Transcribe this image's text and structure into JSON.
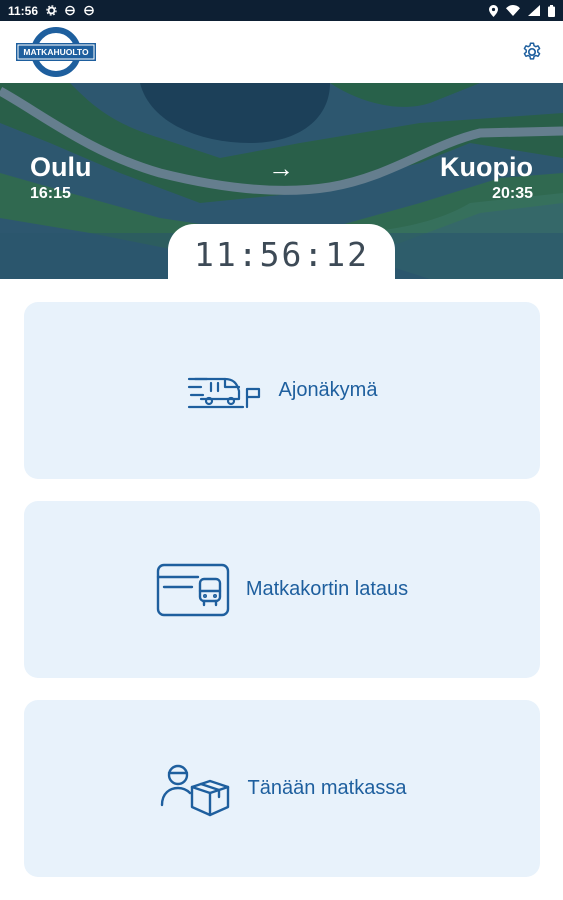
{
  "status_bar": {
    "time": "11:56",
    "icons": [
      "gear-icon",
      "sync-icon",
      "sync-icon"
    ],
    "right_icons": [
      "location-icon",
      "wifi-icon",
      "signal-icon",
      "battery-icon"
    ]
  },
  "app_bar": {
    "logo_text": "MATKAHUOLTO",
    "settings_icon": "gear-icon"
  },
  "route": {
    "from_city": "Oulu",
    "from_time": "16:15",
    "to_city": "Kuopio",
    "to_time": "20:35",
    "arrow": "→"
  },
  "clock": "11:56:12",
  "menu": [
    {
      "label": "Ajonäkymä",
      "icon": "bus-driving-icon"
    },
    {
      "label": "Matkakortin lataus",
      "icon": "travel-card-icon"
    },
    {
      "label": "Tänään matkassa",
      "icon": "passenger-parcel-icon"
    }
  ],
  "colors": {
    "brand_blue": "#1e5f9e",
    "card_bg": "#e8f2fb",
    "status_bar": "#0d1f33"
  }
}
